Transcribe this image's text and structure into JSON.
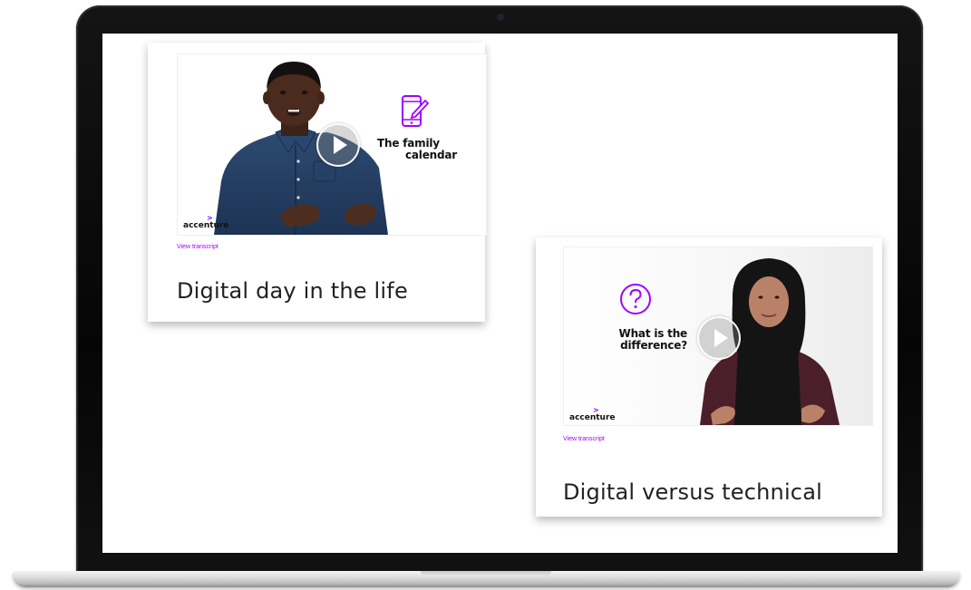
{
  "device": {
    "type": "laptop-mockup",
    "bezel_color": "#0b0b0b",
    "base_color": "#d9d9d9"
  },
  "colors": {
    "accent": "#a100ff",
    "brand_mark": "#8a00e6",
    "text_dark": "#222222"
  },
  "cards": [
    {
      "video": {
        "headline_line1": "The family",
        "headline_line2": "calendar",
        "icon": "phone-edit-icon",
        "brand": "accenture",
        "presenter": "man in denim shirt"
      },
      "transcript_link": "View transcript",
      "title": "Digital day in the life"
    },
    {
      "video": {
        "headline_line1": "What is the",
        "headline_line2": "difference?",
        "icon": "question-circle-icon",
        "brand": "accenture",
        "presenter": "woman in black hijab"
      },
      "transcript_link": "View transcript",
      "title": "Digital versus technical"
    }
  ]
}
